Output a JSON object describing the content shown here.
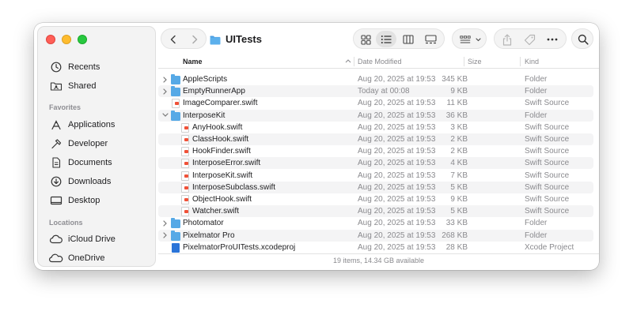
{
  "window": {
    "title": "UITests"
  },
  "sidebar": {
    "top_items": [
      {
        "label": "Recents",
        "icon": "clock-icon"
      },
      {
        "label": "Shared",
        "icon": "shared-folder-icon"
      }
    ],
    "favorites_label": "Favorites",
    "favorites": [
      {
        "label": "Applications",
        "icon": "applications-icon"
      },
      {
        "label": "Developer",
        "icon": "hammer-icon"
      },
      {
        "label": "Documents",
        "icon": "document-icon"
      },
      {
        "label": "Downloads",
        "icon": "download-icon"
      },
      {
        "label": "Desktop",
        "icon": "desktop-icon"
      }
    ],
    "locations_label": "Locations",
    "locations": [
      {
        "label": "iCloud Drive",
        "icon": "cloud-icon"
      },
      {
        "label": "OneDrive",
        "icon": "onedrive-icon"
      }
    ]
  },
  "columns": {
    "name": "Name",
    "date": "Date Modified",
    "size": "Size",
    "kind": "Kind"
  },
  "files": [
    {
      "name": "AppleScripts",
      "date": "Aug 20, 2025 at 19:53",
      "size": "345 KB",
      "kind": "Folder",
      "type": "folder",
      "level": 0,
      "expanded": false
    },
    {
      "name": "EmptyRunnerApp",
      "date": "Today at 00:08",
      "size": "9 KB",
      "kind": "Folder",
      "type": "folder",
      "level": 0,
      "expanded": false
    },
    {
      "name": "ImageComparer.swift",
      "date": "Aug 20, 2025 at 19:53",
      "size": "11 KB",
      "kind": "Swift Source",
      "type": "swift",
      "level": 0
    },
    {
      "name": "InterposeKit",
      "date": "Aug 20, 2025 at 19:53",
      "size": "36 KB",
      "kind": "Folder",
      "type": "folder",
      "level": 0,
      "expanded": true
    },
    {
      "name": "AnyHook.swift",
      "date": "Aug 20, 2025 at 19:53",
      "size": "3 KB",
      "kind": "Swift Source",
      "type": "swift",
      "level": 1
    },
    {
      "name": "ClassHook.swift",
      "date": "Aug 20, 2025 at 19:53",
      "size": "2 KB",
      "kind": "Swift Source",
      "type": "swift",
      "level": 1
    },
    {
      "name": "HookFinder.swift",
      "date": "Aug 20, 2025 at 19:53",
      "size": "2 KB",
      "kind": "Swift Source",
      "type": "swift",
      "level": 1
    },
    {
      "name": "InterposeError.swift",
      "date": "Aug 20, 2025 at 19:53",
      "size": "4 KB",
      "kind": "Swift Source",
      "type": "swift",
      "level": 1
    },
    {
      "name": "InterposeKit.swift",
      "date": "Aug 20, 2025 at 19:53",
      "size": "7 KB",
      "kind": "Swift Source",
      "type": "swift",
      "level": 1
    },
    {
      "name": "InterposeSubclass.swift",
      "date": "Aug 20, 2025 at 19:53",
      "size": "5 KB",
      "kind": "Swift Source",
      "type": "swift",
      "level": 1
    },
    {
      "name": "ObjectHook.swift",
      "date": "Aug 20, 2025 at 19:53",
      "size": "9 KB",
      "kind": "Swift Source",
      "type": "swift",
      "level": 1
    },
    {
      "name": "Watcher.swift",
      "date": "Aug 20, 2025 at 19:53",
      "size": "5 KB",
      "kind": "Swift Source",
      "type": "swift",
      "level": 1
    },
    {
      "name": "Photomator",
      "date": "Aug 20, 2025 at 19:53",
      "size": "33 KB",
      "kind": "Folder",
      "type": "folder",
      "level": 0,
      "expanded": false
    },
    {
      "name": "Pixelmator Pro",
      "date": "Aug 20, 2025 at 19:53",
      "size": "268 KB",
      "kind": "Folder",
      "type": "folder",
      "level": 0,
      "expanded": false
    },
    {
      "name": "PixelmatorProUITests.xcodeproj",
      "date": "Aug 20, 2025 at 19:53",
      "size": "28 KB",
      "kind": "Xcode Project",
      "type": "xcode",
      "level": 0
    }
  ],
  "status": "19 items, 14.34 GB available",
  "colors": {
    "folder": "#56a9e6",
    "swift": "#f05138",
    "close": "#ff5f57",
    "minimize": "#febc2e",
    "maximize": "#28c840"
  }
}
